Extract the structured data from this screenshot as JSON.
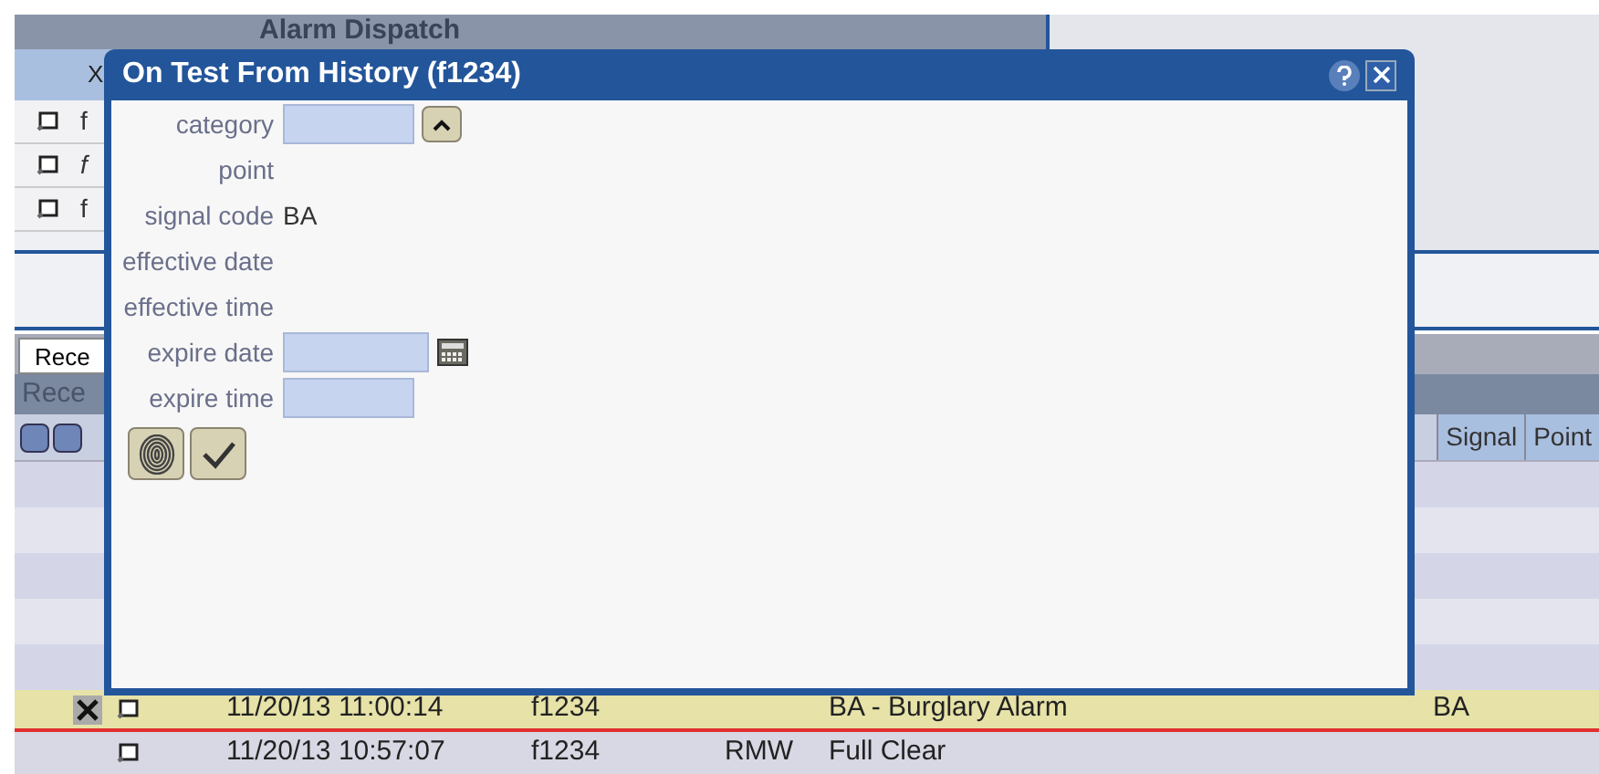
{
  "app": {
    "title": "Alarm Dispatch"
  },
  "top_table": {
    "header": "X",
    "rows": [
      {
        "text": "f",
        "italic": false
      },
      {
        "text": "f",
        "italic": true
      },
      {
        "text": "f",
        "italic": false
      }
    ]
  },
  "lower_panel": {
    "tab": "Rece",
    "header": "Rece",
    "columns": [
      "Signal",
      "Point"
    ]
  },
  "rows": [
    {
      "time": "11/20/13 11:00:14",
      "account": "f1234",
      "event": "BA - Burglary Alarm",
      "signal": "BA",
      "selected": true
    },
    {
      "time": "11/20/13 10:57:07",
      "account": "f1234",
      "user": "RMW",
      "event": "Full Clear",
      "selected": false
    }
  ],
  "dialog": {
    "title": "On Test From History (f1234)",
    "fields": [
      {
        "label": "category",
        "kind": "dropdown"
      },
      {
        "label": "point",
        "kind": "text"
      },
      {
        "label": "signal code",
        "kind": "text",
        "value": "BA"
      },
      {
        "label": "effective date",
        "kind": "text"
      },
      {
        "label": "effective time",
        "kind": "text"
      },
      {
        "label": "expire date",
        "kind": "date"
      },
      {
        "label": "expire time",
        "kind": "input"
      }
    ]
  }
}
